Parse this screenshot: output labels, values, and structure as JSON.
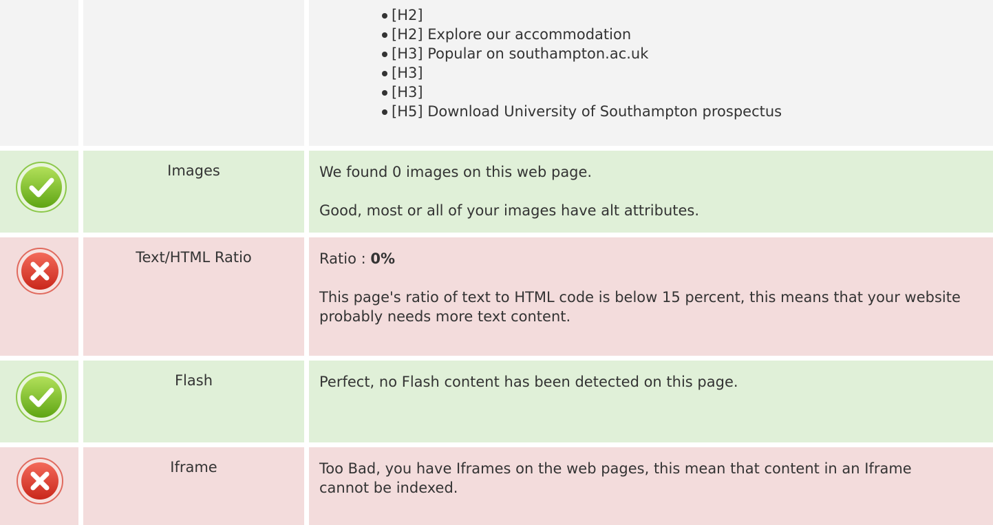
{
  "headings": {
    "items": [
      "[H2]",
      "[H2] Explore our accommodation",
      "[H3] Popular on southampton.ac.uk",
      "[H3]",
      "[H3]",
      "[H5] Download University of Southampton prospectus"
    ]
  },
  "images": {
    "status_icon": "check-circle-icon",
    "label": "Images",
    "line1": "We found 0 images on this web page.",
    "line2": "Good, most or all of your images have alt attributes."
  },
  "ratio": {
    "status_icon": "cross-circle-icon",
    "label": "Text/HTML Ratio",
    "prefix": "Ratio : ",
    "value": "0%",
    "line2": "This page's ratio of text to HTML code is below 15 percent, this means that your website probably needs more text content."
  },
  "flash": {
    "status_icon": "check-circle-icon",
    "label": "Flash",
    "line1": "Perfect, no Flash content has been detected on this page."
  },
  "iframe": {
    "status_icon": "cross-circle-icon",
    "label": "Iframe",
    "line1": "Too Bad, you have Iframes on the web pages, this mean that content in an Iframe cannot be indexed."
  },
  "colors": {
    "pass_bg": "#e0f0d8",
    "fail_bg": "#f3dcdc",
    "neutral_bg": "#f3f3f3",
    "pass_icon": "#7cc423",
    "fail_icon": "#e33b2b"
  }
}
